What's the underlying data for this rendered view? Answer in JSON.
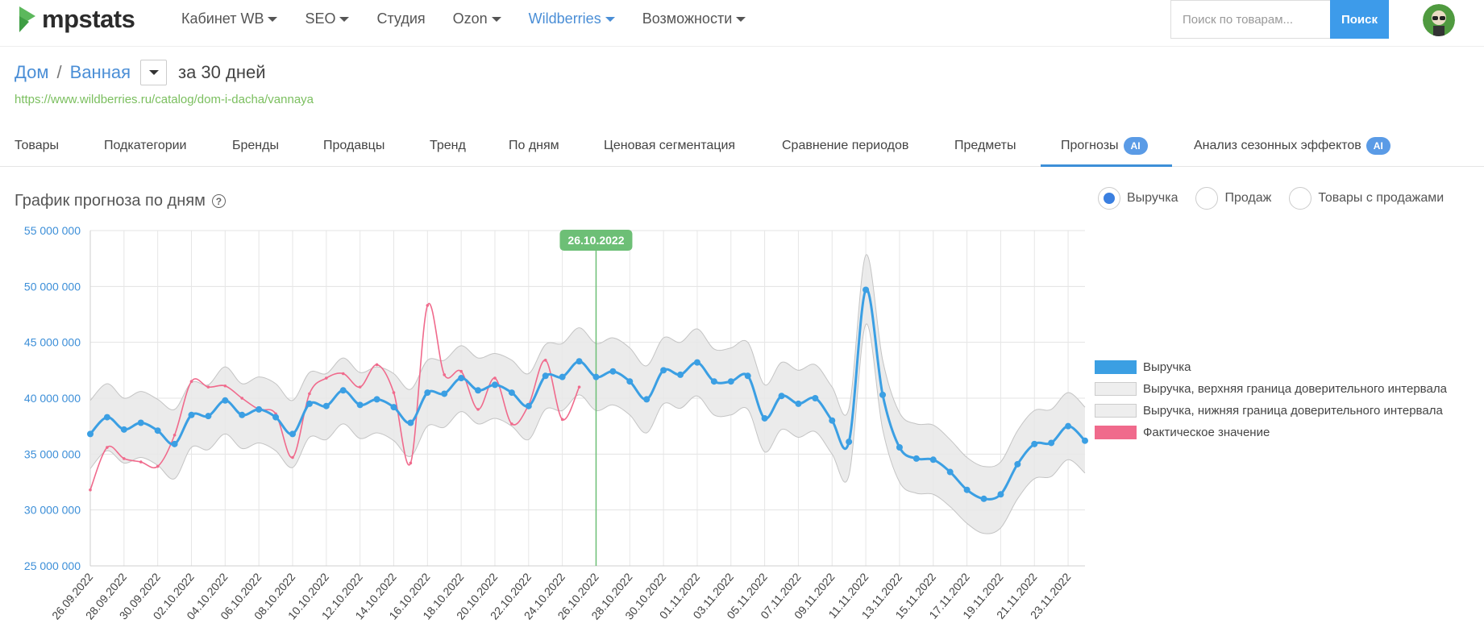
{
  "logo": {
    "text": "mpstats"
  },
  "nav": [
    {
      "label": "Кабинет WB",
      "caret": true,
      "active": false
    },
    {
      "label": "SEO",
      "caret": true,
      "active": false
    },
    {
      "label": "Студия",
      "caret": false,
      "active": false
    },
    {
      "label": "Ozon",
      "caret": true,
      "active": false
    },
    {
      "label": "Wildberries",
      "caret": true,
      "active": true
    },
    {
      "label": "Возможности",
      "caret": true,
      "active": false
    }
  ],
  "search": {
    "placeholder": "Поиск по товарам...",
    "button": "Поиск"
  },
  "breadcrumb": {
    "root": "Дом",
    "sep": "/",
    "current": "Ванная",
    "period": "за 30 дней"
  },
  "url": "https://www.wildberries.ru/catalog/dom-i-dacha/vannaya",
  "tabs": [
    {
      "label": "Товары",
      "badge": ""
    },
    {
      "label": "Подкатегории",
      "badge": ""
    },
    {
      "label": "Бренды",
      "badge": ""
    },
    {
      "label": "Продавцы",
      "badge": ""
    },
    {
      "label": "Тренд",
      "badge": ""
    },
    {
      "label": "По дням",
      "badge": ""
    },
    {
      "label": "Ценовая сегментация",
      "badge": ""
    },
    {
      "label": "Сравнение периодов",
      "badge": ""
    },
    {
      "label": "Предметы",
      "badge": ""
    },
    {
      "label": "Прогнозы",
      "badge": "AI",
      "active": true
    },
    {
      "label": "Анализ сезонных эффектов",
      "badge": "AI"
    }
  ],
  "chart_header": {
    "title": "График прогноза по дням",
    "help": "?"
  },
  "radios": [
    {
      "label": "Выручка",
      "checked": true
    },
    {
      "label": "Продаж",
      "checked": false
    },
    {
      "label": "Товары с продажами",
      "checked": false
    }
  ],
  "legend": [
    {
      "label": "Выручка",
      "color": "#3b9fe3"
    },
    {
      "label": "Выручка, верхняя граница доверительного интервала",
      "color": "#eeeeee"
    },
    {
      "label": "Выручка, нижняя граница доверительного интервала",
      "color": "#eeeeee"
    },
    {
      "label": "Фактическое значение",
      "color": "#f06a8c"
    }
  ],
  "colors": {
    "accent": "#4a8ed6",
    "forecast": "#3b9fe3",
    "actual": "#f06a8c",
    "band": "#e8e8e8",
    "today": "#6dbf76"
  },
  "chart_data": {
    "type": "line",
    "ylim": [
      25000000,
      55000000
    ],
    "yticks": [
      {
        "value": 25000000,
        "label": "25 000 000"
      },
      {
        "value": 30000000,
        "label": "30 000 000"
      },
      {
        "value": 35000000,
        "label": "35 000 000"
      },
      {
        "value": 40000000,
        "label": "40 000 000"
      },
      {
        "value": 45000000,
        "label": "45 000 000"
      },
      {
        "value": 50000000,
        "label": "50 000 000"
      },
      {
        "value": 55000000,
        "label": "55 000 000"
      }
    ],
    "x": [
      "26.09.2022",
      "27.09.2022",
      "28.09.2022",
      "29.09.2022",
      "30.09.2022",
      "01.10.2022",
      "02.10.2022",
      "03.10.2022",
      "04.10.2022",
      "05.10.2022",
      "06.10.2022",
      "07.10.2022",
      "08.10.2022",
      "09.10.2022",
      "10.10.2022",
      "11.10.2022",
      "12.10.2022",
      "13.10.2022",
      "14.10.2022",
      "15.10.2022",
      "16.10.2022",
      "17.10.2022",
      "18.10.2022",
      "19.10.2022",
      "20.10.2022",
      "21.10.2022",
      "22.10.2022",
      "23.10.2022",
      "24.10.2022",
      "25.10.2022",
      "26.10.2022",
      "27.10.2022",
      "28.10.2022",
      "29.10.2022",
      "30.10.2022",
      "31.10.2022",
      "01.11.2022",
      "02.11.2022",
      "03.11.2022",
      "04.11.2022",
      "05.11.2022",
      "06.11.2022",
      "07.11.2022",
      "08.11.2022",
      "09.11.2022",
      "10.11.2022",
      "11.11.2022",
      "12.11.2022",
      "13.11.2022",
      "14.11.2022",
      "15.11.2022",
      "16.11.2022",
      "17.11.2022",
      "18.11.2022",
      "19.11.2022",
      "20.11.2022",
      "21.11.2022",
      "22.11.2022",
      "23.11.2022",
      "24.11.2022"
    ],
    "xtick_labels": [
      "26.09.2022",
      "28.09.2022",
      "30.09.2022",
      "02.10.2022",
      "04.10.2022",
      "06.10.2022",
      "08.10.2022",
      "10.10.2022",
      "12.10.2022",
      "14.10.2022",
      "16.10.2022",
      "18.10.2022",
      "20.10.2022",
      "22.10.2022",
      "24.10.2022",
      "26.10.2022",
      "28.10.2022",
      "30.10.2022",
      "01.11.2022",
      "03.11.2022",
      "05.11.2022",
      "07.11.2022",
      "09.11.2022",
      "11.11.2022",
      "13.11.2022",
      "15.11.2022",
      "17.11.2022",
      "19.11.2022",
      "21.11.2022",
      "23.11.2022"
    ],
    "marker": {
      "x": "26.10.2022",
      "label": "26.10.2022"
    },
    "series": [
      {
        "name": "Выручка",
        "values": [
          36800000,
          38300000,
          37200000,
          37800000,
          37100000,
          35900000,
          38500000,
          38400000,
          39800000,
          38500000,
          39000000,
          38300000,
          36800000,
          39500000,
          39300000,
          40700000,
          39400000,
          39900000,
          39200000,
          37800000,
          40500000,
          40400000,
          41800000,
          40700000,
          41200000,
          40500000,
          39300000,
          42000000,
          41900000,
          43300000,
          41900000,
          42400000,
          41500000,
          39900000,
          42500000,
          42100000,
          43200000,
          41500000,
          41500000,
          42000000,
          38200000,
          40200000,
          39500000,
          40000000,
          38000000,
          36100000,
          49700000,
          40300000,
          35600000,
          34600000,
          34500000,
          33400000,
          31800000,
          31000000,
          31400000,
          34100000,
          35900000,
          36000000,
          37500000,
          36200000
        ]
      },
      {
        "name": "Выручка, верхняя граница доверительного интервала",
        "values": [
          39800000,
          41300000,
          40000000,
          40600000,
          39900000,
          39000000,
          41400000,
          41200000,
          42800000,
          41300000,
          41900000,
          41300000,
          39800000,
          42300000,
          42200000,
          43600000,
          42300000,
          42800000,
          42200000,
          40800000,
          43400000,
          43400000,
          44700000,
          43600000,
          44000000,
          43400000,
          42200000,
          44800000,
          44900000,
          46300000,
          44900000,
          45400000,
          44500000,
          42900000,
          45400000,
          45000000,
          46200000,
          44400000,
          44500000,
          45000000,
          41200000,
          43200000,
          42500000,
          43000000,
          41000000,
          39100000,
          52800000,
          43400000,
          38700000,
          37700000,
          37600000,
          36300000,
          34700000,
          33900000,
          34300000,
          37100000,
          38900000,
          39000000,
          40500000,
          39200000
        ]
      },
      {
        "name": "Выручка, нижняя граница доверительного интервала",
        "values": [
          33700000,
          35300000,
          34200000,
          34700000,
          34000000,
          32800000,
          35600000,
          35400000,
          36800000,
          35500000,
          36000000,
          35300000,
          33800000,
          36500000,
          36300000,
          37700000,
          36400000,
          36900000,
          36200000,
          34800000,
          37500000,
          37400000,
          38800000,
          37700000,
          38200000,
          37500000,
          36300000,
          39000000,
          38900000,
          40300000,
          38900000,
          39400000,
          38500000,
          36900000,
          39500000,
          39100000,
          40200000,
          38500000,
          38500000,
          39000000,
          35200000,
          37200000,
          36500000,
          37000000,
          35000000,
          33100000,
          46600000,
          37200000,
          32500000,
          31500000,
          31400000,
          30300000,
          28800000,
          27900000,
          28400000,
          31000000,
          32800000,
          33000000,
          34500000,
          33300000
        ]
      },
      {
        "name": "Фактическое значение",
        "values": [
          31800000,
          35600000,
          34600000,
          34300000,
          33900000,
          36700000,
          41500000,
          41000000,
          41100000,
          40000000,
          39000000,
          38600000,
          34700000,
          40400000,
          41800000,
          42200000,
          41000000,
          43000000,
          40500000,
          34200000,
          48300000,
          42100000,
          42400000,
          39000000,
          41800000,
          37700000,
          39400000,
          43400000,
          38100000,
          41000000,
          null,
          null,
          null,
          null,
          null,
          null,
          null,
          null,
          null,
          null,
          null,
          null,
          null,
          null,
          null,
          null,
          null,
          null,
          null,
          null,
          null,
          null,
          null,
          null,
          null,
          null,
          null,
          null,
          null,
          null
        ]
      }
    ]
  }
}
